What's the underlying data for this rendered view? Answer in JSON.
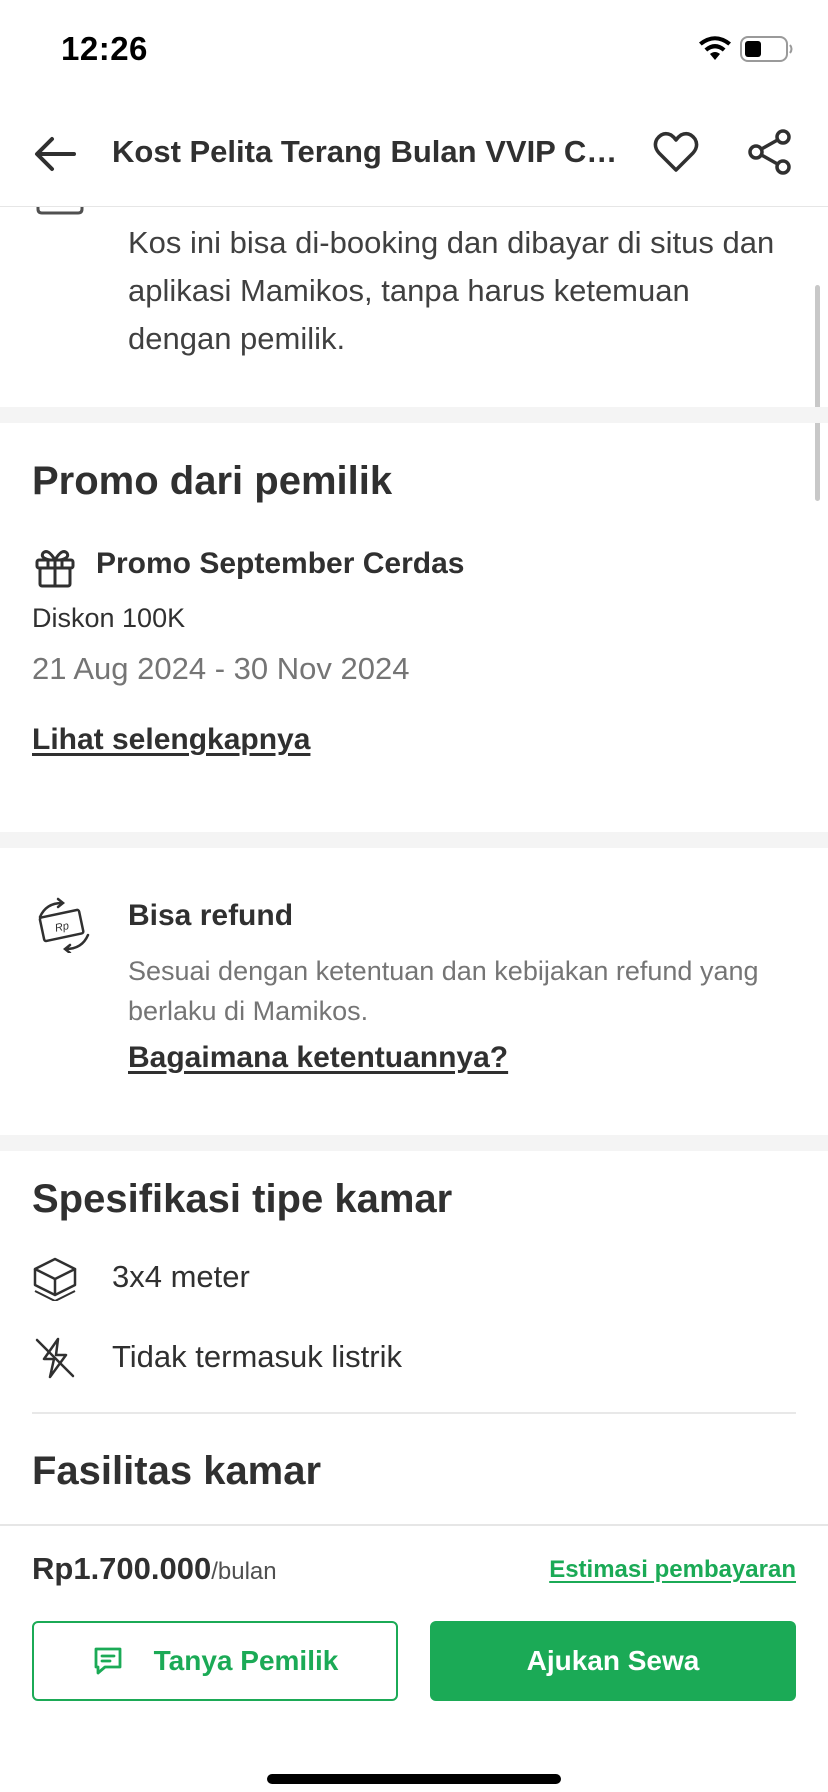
{
  "status_bar": {
    "time": "12:26"
  },
  "header": {
    "title": "Kost Pelita Terang Bulan VVIP Cik...",
    "icons": [
      "back-arrow-icon",
      "heart-icon",
      "share-icon"
    ]
  },
  "booking_info": {
    "description": "Kos ini bisa di-booking dan dibayar di situs dan aplikasi Mamikos, tanpa harus ketemuan dengan pemilik."
  },
  "promo": {
    "section_title": "Promo dari pemilik",
    "name": "Promo September Cerdas",
    "discount": "Diskon 100K",
    "dates": "21 Aug 2024 - 30 Nov 2024",
    "link_label": "Lihat selengkapnya"
  },
  "refund": {
    "title": "Bisa refund",
    "description": "Sesuai dengan ketentuan dan kebijakan refund yang berlaku di Mamikos.",
    "link_label": "Bagaimana ketentuannya?"
  },
  "room_spec": {
    "section_title": "Spesifikasi tipe kamar",
    "items": [
      {
        "icon": "room-size-icon",
        "label": "3x4 meter"
      },
      {
        "icon": "no-electricity-icon",
        "label": "Tidak termasuk listrik"
      }
    ]
  },
  "facilities": {
    "section_title": "Fasilitas kamar"
  },
  "bottom_bar": {
    "price": "Rp1.700.000",
    "period": "/bulan",
    "estimate_label": "Estimasi pembayaran",
    "ask_owner_label": "Tanya Pemilik",
    "apply_label": "Ajukan Sewa"
  },
  "colors": {
    "accent_green": "#1baa56",
    "text_primary": "#303030",
    "text_secondary": "#757575"
  }
}
